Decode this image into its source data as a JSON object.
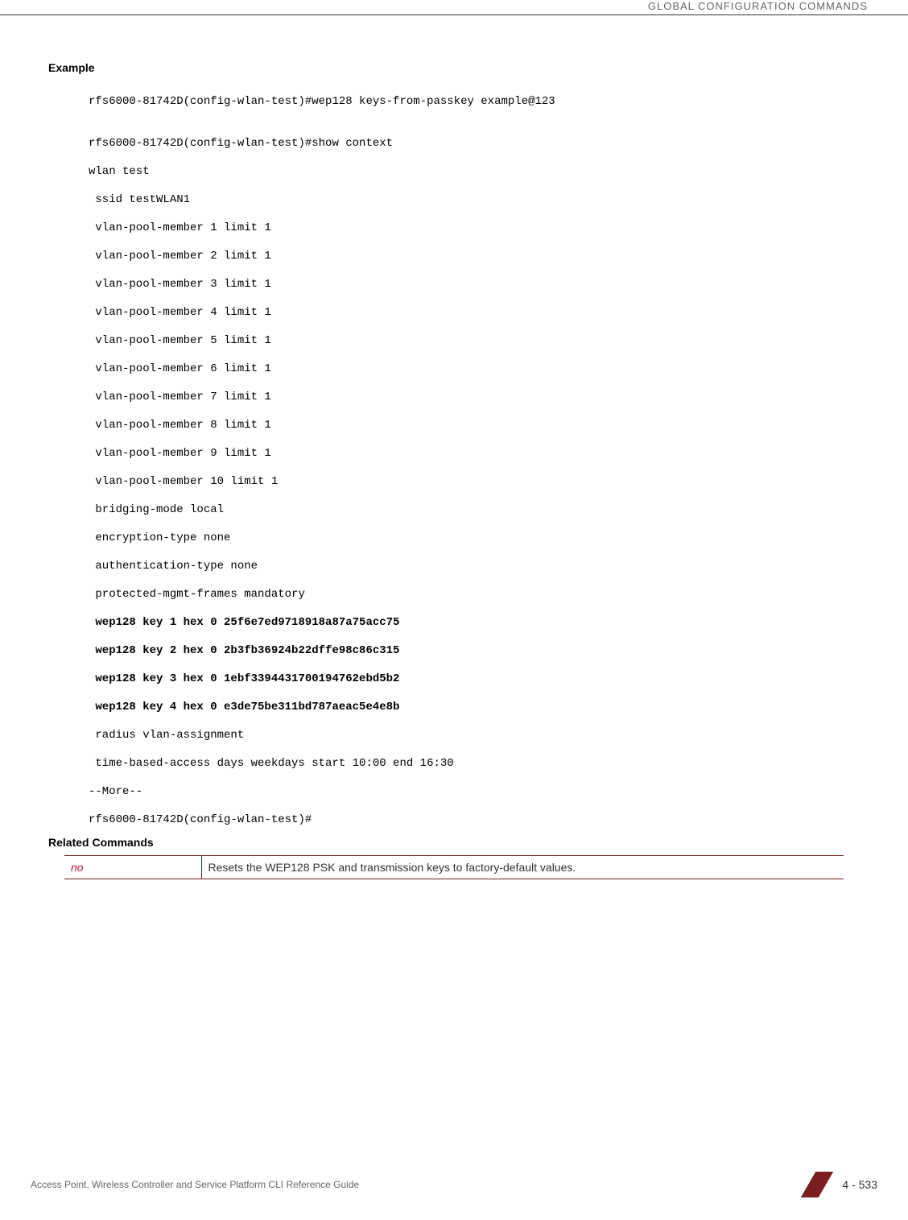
{
  "header": {
    "title": "GLOBAL CONFIGURATION COMMANDS"
  },
  "sections": {
    "example_heading": "Example",
    "code": {
      "line1": "rfs6000-81742D(config-wlan-test)#wep128 keys-from-passkey example@123",
      "blank1": "",
      "line2": "rfs6000-81742D(config-wlan-test)#show context",
      "line3": "wlan test",
      "line4": " ssid testWLAN1",
      "line5": " vlan-pool-member 1 limit 1",
      "line6": " vlan-pool-member 2 limit 1",
      "line7": " vlan-pool-member 3 limit 1",
      "line8": " vlan-pool-member 4 limit 1",
      "line9": " vlan-pool-member 5 limit 1",
      "line10": " vlan-pool-member 6 limit 1",
      "line11": " vlan-pool-member 7 limit 1",
      "line12": " vlan-pool-member 8 limit 1",
      "line13": " vlan-pool-member 9 limit 1",
      "line14": " vlan-pool-member 10 limit 1",
      "line15": " bridging-mode local",
      "line16": " encryption-type none",
      "line17": " authentication-type none",
      "line18": " protected-mgmt-frames mandatory",
      "line19": " wep128 key 1 hex 0 25f6e7ed9718918a87a75acc75",
      "line20": " wep128 key 2 hex 0 2b3fb36924b22dffe98c86c315",
      "line21": " wep128 key 3 hex 0 1ebf3394431700194762ebd5b2",
      "line22": " wep128 key 4 hex 0 e3de75be311bd787aeac5e4e8b",
      "line23": " radius vlan-assignment",
      "line24": " time-based-access days weekdays start 10:00 end 16:30",
      "line25": "--More--",
      "line26": "rfs6000-81742D(config-wlan-test)#"
    },
    "related_heading": "Related Commands",
    "related_table": {
      "cmd": "no",
      "desc": "Resets the WEP128 PSK and transmission keys to factory-default values."
    }
  },
  "footer": {
    "text": "Access Point, Wireless Controller and Service Platform CLI Reference Guide",
    "page": "4 - 533"
  }
}
